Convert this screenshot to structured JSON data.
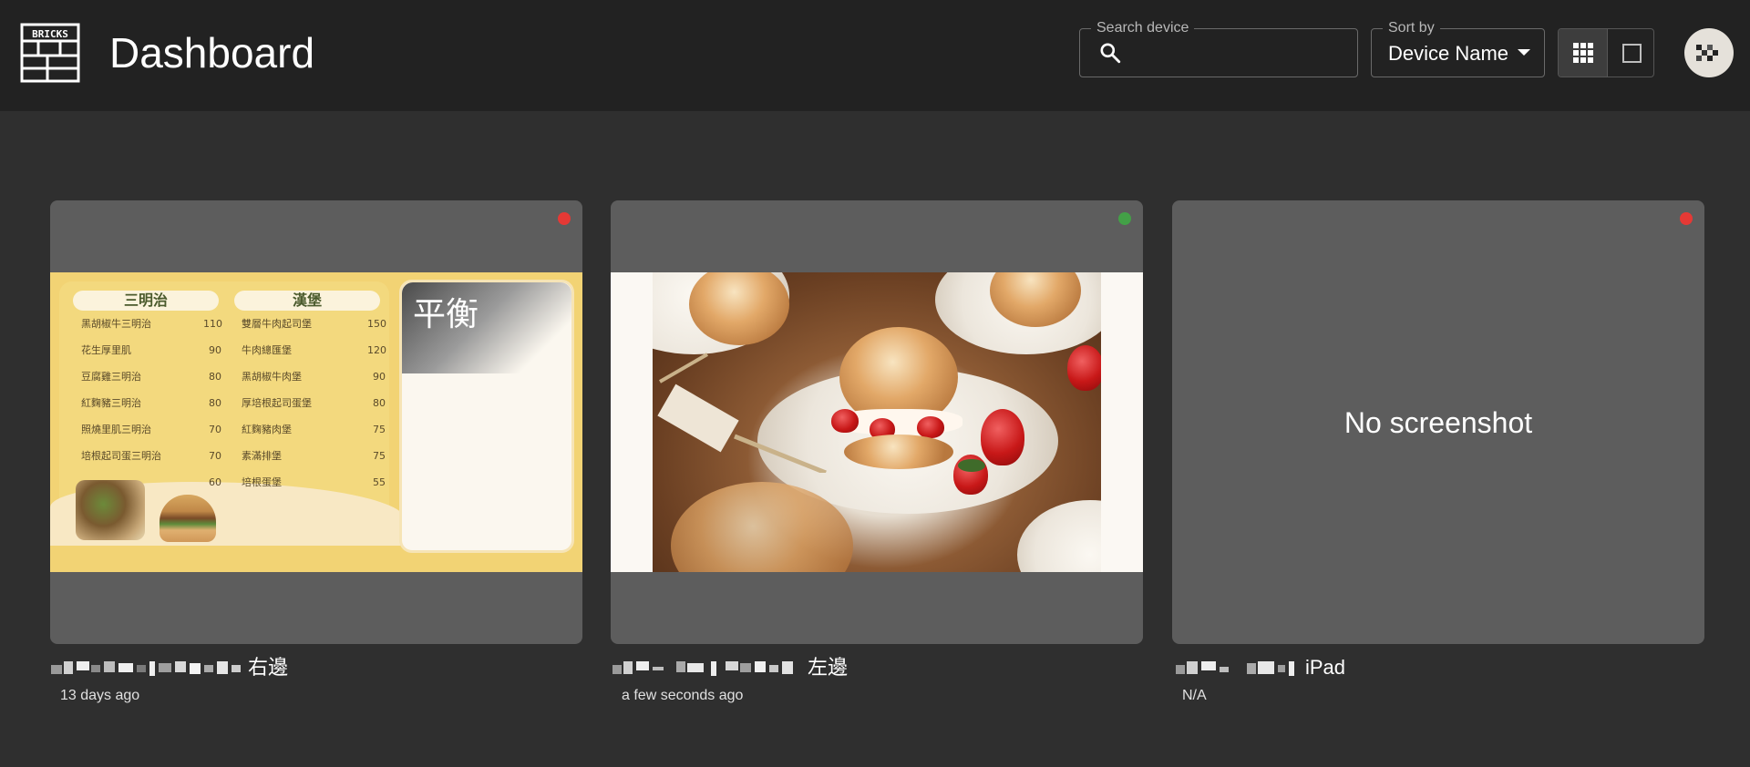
{
  "header": {
    "logo_text": "BRICKS",
    "title": "Dashboard",
    "search": {
      "label": "Search device",
      "value": "",
      "placeholder": ""
    },
    "sort": {
      "label": "Sort by",
      "selected": "Device Name"
    },
    "view_toggle": {
      "grid_icon": "grid-view-icon",
      "single_icon": "single-view-icon",
      "active": "grid"
    }
  },
  "devices": [
    {
      "name_suffix": "右邊",
      "last_seen": "13 days ago",
      "status": "offline",
      "status_color": "#e53935",
      "preview": "menu",
      "menu": {
        "left_heading": "三明治",
        "right_heading": "漢堡",
        "banner_text": "平衡",
        "left_items": [
          {
            "name": "黑胡椒牛三明治",
            "price": "110"
          },
          {
            "name": "花生厚里肌",
            "price": "90"
          },
          {
            "name": "豆腐雞三明治",
            "price": "80"
          },
          {
            "name": "紅麴豬三明治",
            "price": "80"
          },
          {
            "name": "照燒里肌三明治",
            "price": "70"
          },
          {
            "name": "培根起司蛋三明治",
            "price": "70"
          },
          {
            "name": "",
            "price": "60"
          }
        ],
        "right_items": [
          {
            "name": "雙層牛肉起司堡",
            "price": "150"
          },
          {
            "name": "牛肉總匯堡",
            "price": "120"
          },
          {
            "name": "黑胡椒牛肉堡",
            "price": "90"
          },
          {
            "name": "厚培根起司蛋堡",
            "price": "80"
          },
          {
            "name": "紅麴豬肉堡",
            "price": "75"
          },
          {
            "name": "素滿排堡",
            "price": "75"
          },
          {
            "name": "培根蛋堡",
            "price": "55"
          }
        ]
      }
    },
    {
      "name_suffix": "左邊",
      "last_seen": "a few seconds ago",
      "status": "online",
      "status_color": "#43a047",
      "preview": "dessert"
    },
    {
      "name_suffix": "iPad",
      "last_seen": "N/A",
      "status": "offline",
      "status_color": "#e53935",
      "preview": "none",
      "no_screenshot_text": "No screenshot"
    }
  ],
  "colors": {
    "appbar": "#222222",
    "background": "#2f2f2f",
    "card": "#5d5d5d"
  }
}
